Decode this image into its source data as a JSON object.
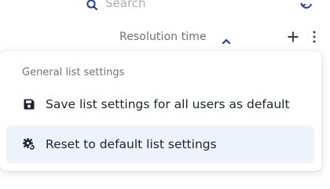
{
  "search": {
    "placeholder": "Search",
    "icon": "search-icon"
  },
  "toolbar": {
    "refresh_icon": "refresh-icon"
  },
  "header": {
    "column_title": "Resolution time",
    "sort_icon": "chevron-up-icon",
    "add_icon": "plus-icon",
    "more_icon": "kebab-menu-icon"
  },
  "menu": {
    "section_title": "General list settings",
    "items": [
      {
        "label": "Save list settings for all users as default",
        "icon": "floppy-disk-icon"
      },
      {
        "label": "Reset to default list settings",
        "icon": "gear-reset-icon"
      }
    ]
  },
  "colors": {
    "text_primary": "#1e2230",
    "text_muted": "#6b6f7a",
    "highlight": "#eef2fb",
    "accent": "#1f3fa0"
  }
}
